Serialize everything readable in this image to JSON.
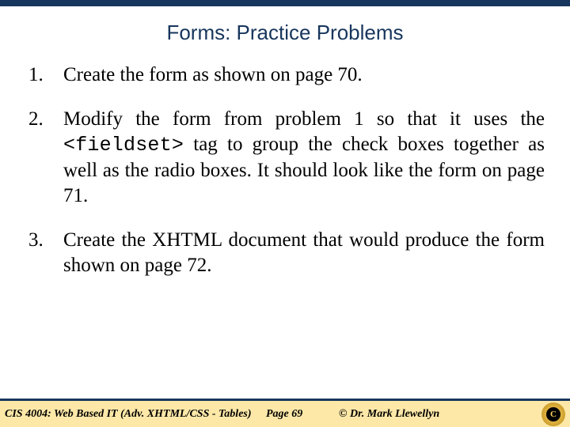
{
  "title": "Forms: Practice Problems",
  "items": [
    {
      "num": "1.",
      "text": "Create the form as shown on page 70."
    },
    {
      "num": "2.",
      "pre": "Modify the form from problem 1 so that it uses the ",
      "code": "<fieldset>",
      "post": " tag to group the check boxes together as well as the radio boxes.  It should look like the form on page 71."
    },
    {
      "num": "3.",
      "text": "Create the XHTML document that would produce the form shown on page 72."
    }
  ],
  "footer": {
    "course": "CIS 4004: Web Based IT (Adv. XHTML/CSS - Tables)",
    "page": "Page 69",
    "copyright": "© Dr. Mark Llewellyn"
  },
  "logo_letter": "C"
}
